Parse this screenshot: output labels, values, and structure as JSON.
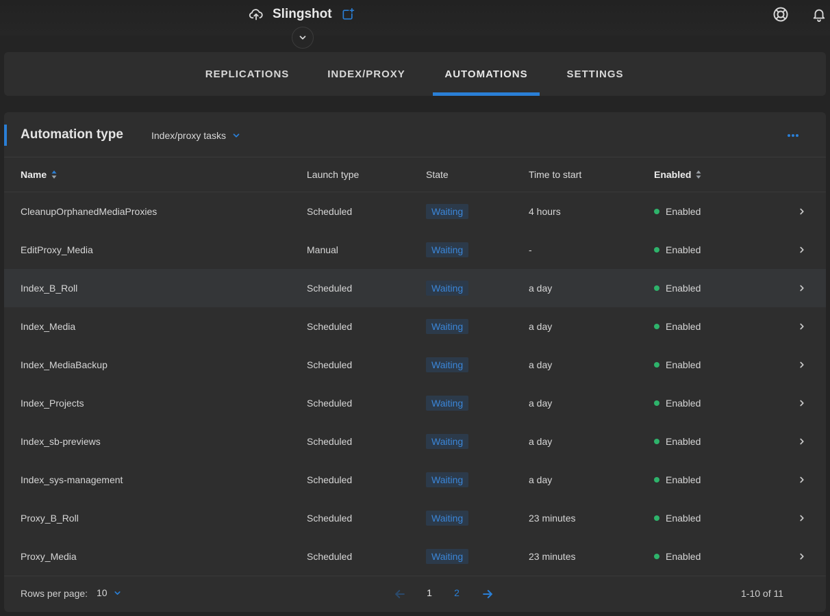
{
  "header": {
    "app_title": "Slingshot",
    "icons": [
      "cloud-upload-icon",
      "new-window-icon",
      "chevron-down-icon",
      "help-lifebuoy-icon",
      "bell-icon"
    ]
  },
  "tabs": [
    {
      "label": "REPLICATIONS",
      "active": false
    },
    {
      "label": "INDEX/PROXY",
      "active": false
    },
    {
      "label": "AUTOMATIONS",
      "active": true
    },
    {
      "label": "SETTINGS",
      "active": false
    }
  ],
  "card": {
    "title": "Automation type",
    "type_selected": "Index/proxy tasks"
  },
  "table": {
    "columns": [
      "Name",
      "Launch type",
      "State",
      "Time to start",
      "Enabled"
    ],
    "rows": [
      {
        "name": "CleanupOrphanedMediaProxies",
        "launch": "Scheduled",
        "state": "Waiting",
        "time": "4 hours",
        "enabled": "Enabled"
      },
      {
        "name": "EditProxy_Media",
        "launch": "Manual",
        "state": "Waiting",
        "time": "-",
        "enabled": "Enabled"
      },
      {
        "name": "Index_B_Roll",
        "launch": "Scheduled",
        "state": "Waiting",
        "time": "a day",
        "enabled": "Enabled"
      },
      {
        "name": "Index_Media",
        "launch": "Scheduled",
        "state": "Waiting",
        "time": "a day",
        "enabled": "Enabled"
      },
      {
        "name": "Index_MediaBackup",
        "launch": "Scheduled",
        "state": "Waiting",
        "time": "a day",
        "enabled": "Enabled"
      },
      {
        "name": "Index_Projects",
        "launch": "Scheduled",
        "state": "Waiting",
        "time": "a day",
        "enabled": "Enabled"
      },
      {
        "name": "Index_sb-previews",
        "launch": "Scheduled",
        "state": "Waiting",
        "time": "a day",
        "enabled": "Enabled"
      },
      {
        "name": "Index_sys-management",
        "launch": "Scheduled",
        "state": "Waiting",
        "time": "a day",
        "enabled": "Enabled"
      },
      {
        "name": "Proxy_B_Roll",
        "launch": "Scheduled",
        "state": "Waiting",
        "time": "23 minutes",
        "enabled": "Enabled"
      },
      {
        "name": "Proxy_Media",
        "launch": "Scheduled",
        "state": "Waiting",
        "time": "23 minutes",
        "enabled": "Enabled"
      }
    ]
  },
  "footer": {
    "rows_label": "Rows per page:",
    "rows_value": "10",
    "pages": [
      "1",
      "2"
    ],
    "range": "1-10 of 11"
  },
  "colors": {
    "accent": "#2a7fd6",
    "enabled_dot": "#2eb36b",
    "badge_bg": "#2c3a4a"
  }
}
